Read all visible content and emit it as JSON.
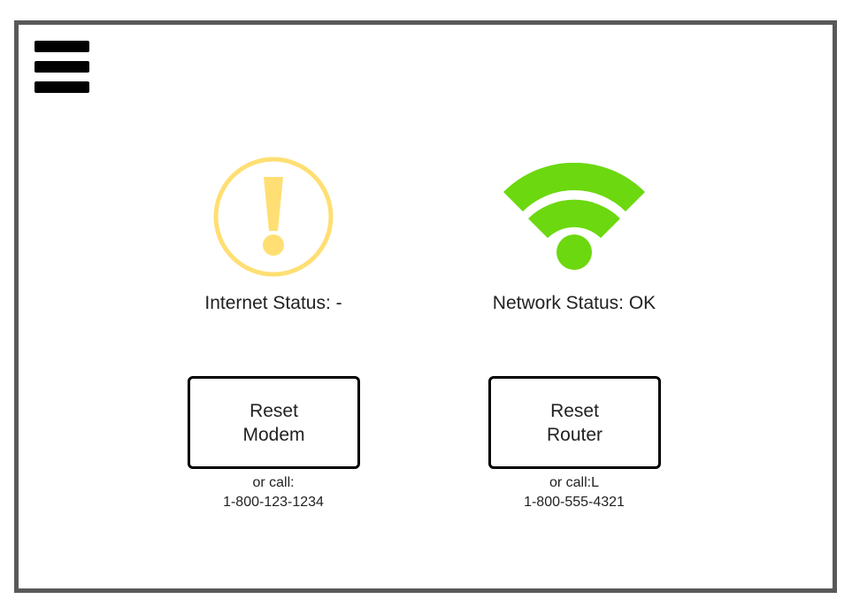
{
  "menu": {
    "icon": "hamburger-menu-icon"
  },
  "internet": {
    "icon": "warning-icon",
    "icon_color": "#FFDF73",
    "status_label": "Internet Status: -",
    "reset_label": "Reset\nModem",
    "call_prefix": "or call:",
    "phone": "1-800-123-1234"
  },
  "network": {
    "icon": "wifi-icon",
    "icon_color": "#6CD80F",
    "status_label": "Network Status: OK",
    "reset_label": "Reset\nRouter",
    "call_prefix": "or call:L",
    "phone": "1-800-555-4321"
  },
  "colors": {
    "frame_border": "#595959",
    "button_border": "#000000"
  }
}
